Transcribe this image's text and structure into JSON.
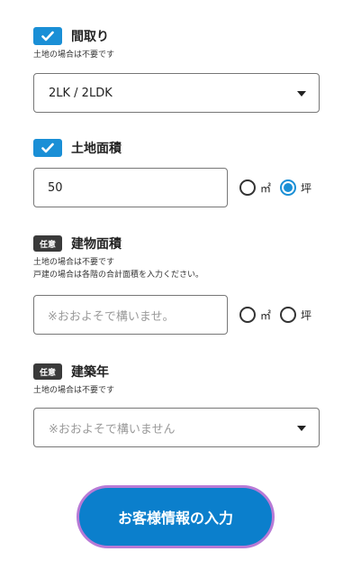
{
  "madori": {
    "title": "間取り",
    "note": "土地の場合は不要です",
    "selected": "2LK / 2LDK"
  },
  "tochi_menseki": {
    "title": "土地面積",
    "value": "50",
    "unit_options": [
      "㎡",
      "坪"
    ],
    "selected_unit": "坪"
  },
  "tatemono_menseki": {
    "badge": "任意",
    "title": "建物面積",
    "note_lines": [
      "土地の場合は不要です",
      "戸建の場合は各階の合計面積を入力ください。"
    ],
    "placeholder": "※おおよそで構いませ。",
    "unit_options": [
      "㎡",
      "坪"
    ]
  },
  "chikunen": {
    "badge": "任意",
    "title": "建築年",
    "note": "土地の場合は不要です",
    "placeholder": "※おおよそで構いません"
  },
  "submit": {
    "label": "お客様情報の入力"
  },
  "colors": {
    "accent": "#1a8fd6",
    "button": "#0b7fcc",
    "button_border": "#b77ad6",
    "optional_badge": "#3a3a3a"
  }
}
